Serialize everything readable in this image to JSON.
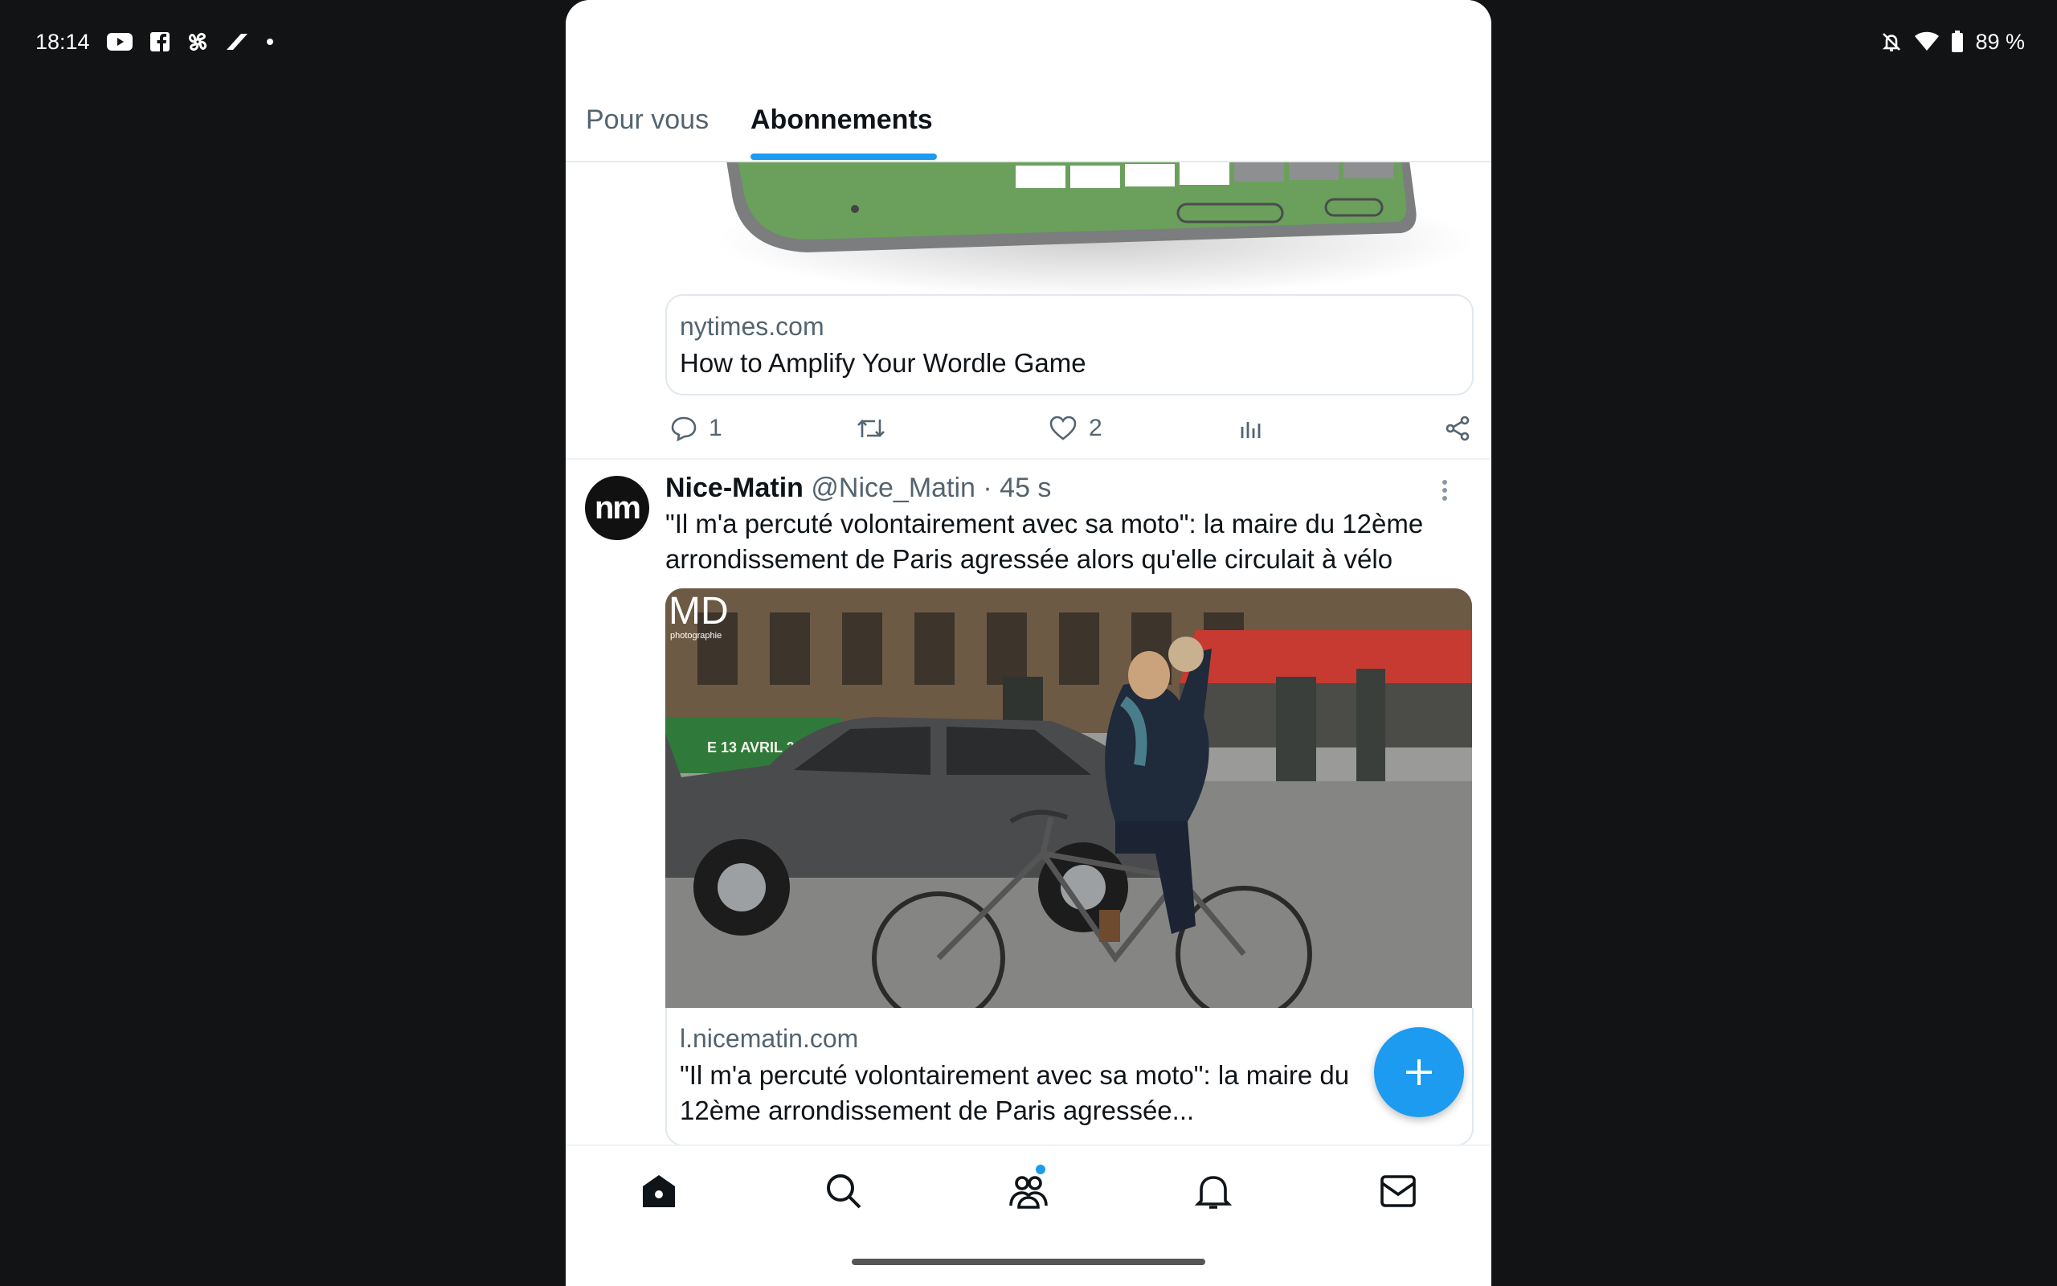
{
  "status_bar": {
    "time": "18:14",
    "notification_icons": [
      "youtube-icon",
      "facebook-icon",
      "pinwheel-icon",
      "feather-icon",
      "dot-icon"
    ],
    "right_icons": [
      "bell-off-icon",
      "wifi-icon",
      "battery-icon"
    ],
    "battery": "89 %"
  },
  "tabs": [
    {
      "label": "Pour vous",
      "active": false
    },
    {
      "label": "Abonnements",
      "active": true
    }
  ],
  "tweet1": {
    "card": {
      "domain": "nytimes.com",
      "title": "How to Amplify Your Wordle Game"
    },
    "actions": {
      "replies": "1",
      "retweets": "",
      "likes": "2"
    }
  },
  "tweet2": {
    "avatar_text": "nm",
    "name": "Nice-Matin",
    "meta": "@Nice_Matin · 45 s",
    "text": "\"Il m'a percuté volontairement avec sa moto\": la maire du 12ème arrondissement de Paris agressée alors qu'elle circulait à vélo",
    "photo_watermark": "MD",
    "photo_watermark_sub": "photographie",
    "banner_text": "E 13 AVRIL 2015",
    "card": {
      "domain": "l.nicematin.com",
      "title": "\"Il m'a percuté volontairement avec sa moto\": la maire du 12ème arrondissement de Paris agressée..."
    }
  },
  "bottom_nav": [
    "home-icon",
    "search-icon",
    "communities-icon",
    "notifications-icon",
    "messages-icon"
  ],
  "colors": {
    "accent": "#1d9bf0",
    "text": "#0f1419",
    "muted": "#536471"
  }
}
